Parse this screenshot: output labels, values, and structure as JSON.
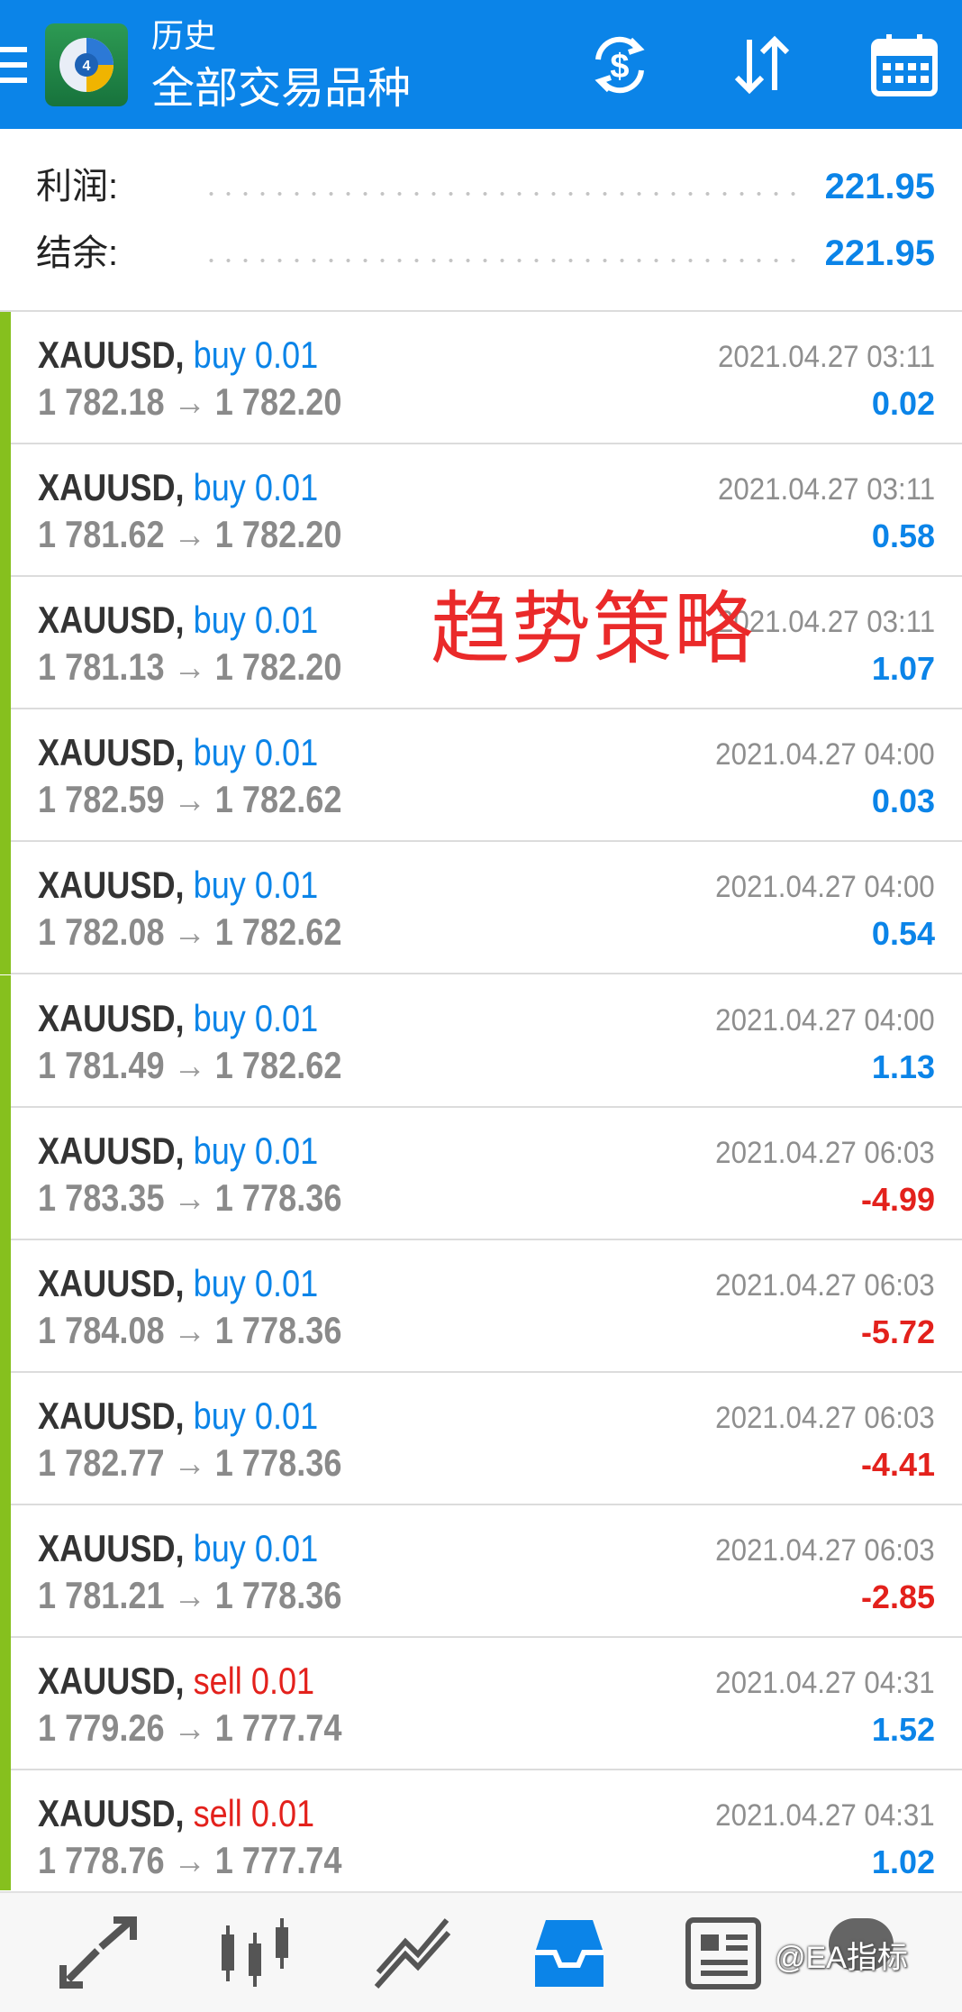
{
  "header": {
    "title": "历史",
    "subtitle": "全部交易品种",
    "icons": [
      "menu-icon",
      "app-logo",
      "currency-exchange-icon",
      "sort-icon",
      "calendar-icon"
    ]
  },
  "summary": {
    "profit_label": "利润:",
    "profit_value": "221.95",
    "balance_label": "结余:",
    "balance_value": "221.95"
  },
  "trades": [
    {
      "symbol": "XAUUSD,",
      "side": "buy",
      "volume": "0.01",
      "open_price": "1 782.18",
      "close_price": "1 782.20",
      "time": "2021.04.27 03:11",
      "profit": "0.02"
    },
    {
      "symbol": "XAUUSD,",
      "side": "buy",
      "volume": "0.01",
      "open_price": "1 781.62",
      "close_price": "1 782.20",
      "time": "2021.04.27 03:11",
      "profit": "0.58"
    },
    {
      "symbol": "XAUUSD,",
      "side": "buy",
      "volume": "0.01",
      "open_price": "1 781.13",
      "close_price": "1 782.20",
      "time": "2021.04.27 03:11",
      "profit": "1.07"
    },
    {
      "symbol": "XAUUSD,",
      "side": "buy",
      "volume": "0.01",
      "open_price": "1 782.59",
      "close_price": "1 782.62",
      "time": "2021.04.27 04:00",
      "profit": "0.03"
    },
    {
      "symbol": "XAUUSD,",
      "side": "buy",
      "volume": "0.01",
      "open_price": "1 782.08",
      "close_price": "1 782.62",
      "time": "2021.04.27 04:00",
      "profit": "0.54"
    },
    {
      "symbol": "XAUUSD,",
      "side": "buy",
      "volume": "0.01",
      "open_price": "1 781.49",
      "close_price": "1 782.62",
      "time": "2021.04.27 04:00",
      "profit": "1.13"
    },
    {
      "symbol": "XAUUSD,",
      "side": "buy",
      "volume": "0.01",
      "open_price": "1 783.35",
      "close_price": "1 778.36",
      "time": "2021.04.27 06:03",
      "profit": "-4.99"
    },
    {
      "symbol": "XAUUSD,",
      "side": "buy",
      "volume": "0.01",
      "open_price": "1 784.08",
      "close_price": "1 778.36",
      "time": "2021.04.27 06:03",
      "profit": "-5.72"
    },
    {
      "symbol": "XAUUSD,",
      "side": "buy",
      "volume": "0.01",
      "open_price": "1 782.77",
      "close_price": "1 778.36",
      "time": "2021.04.27 06:03",
      "profit": "-4.41"
    },
    {
      "symbol": "XAUUSD,",
      "side": "buy",
      "volume": "0.01",
      "open_price": "1 781.21",
      "close_price": "1 778.36",
      "time": "2021.04.27 06:03",
      "profit": "-2.85"
    },
    {
      "symbol": "XAUUSD,",
      "side": "sell",
      "volume": "0.01",
      "open_price": "1 779.26",
      "close_price": "1 777.74",
      "time": "2021.04.27 04:31",
      "profit": "1.52"
    },
    {
      "symbol": "XAUUSD,",
      "side": "sell",
      "volume": "0.01",
      "open_price": "1 778.76",
      "close_price": "1 777.74",
      "time": "2021.04.27 04:31",
      "profit": "1.02"
    }
  ],
  "overlay_text": "趋势策略",
  "bottom_nav": {
    "items": [
      "quotes-icon",
      "chart-icon",
      "trade-icon",
      "history-icon",
      "news-icon"
    ],
    "active": "history-icon"
  },
  "colors": {
    "header_bg": "#0b84e8",
    "buy": "#0b84e8",
    "sell": "#e3211c",
    "profit_positive": "#0b84e8",
    "profit_negative": "#e3211c",
    "trade_bar": "#86c01e"
  },
  "watermark": "@EA指标"
}
